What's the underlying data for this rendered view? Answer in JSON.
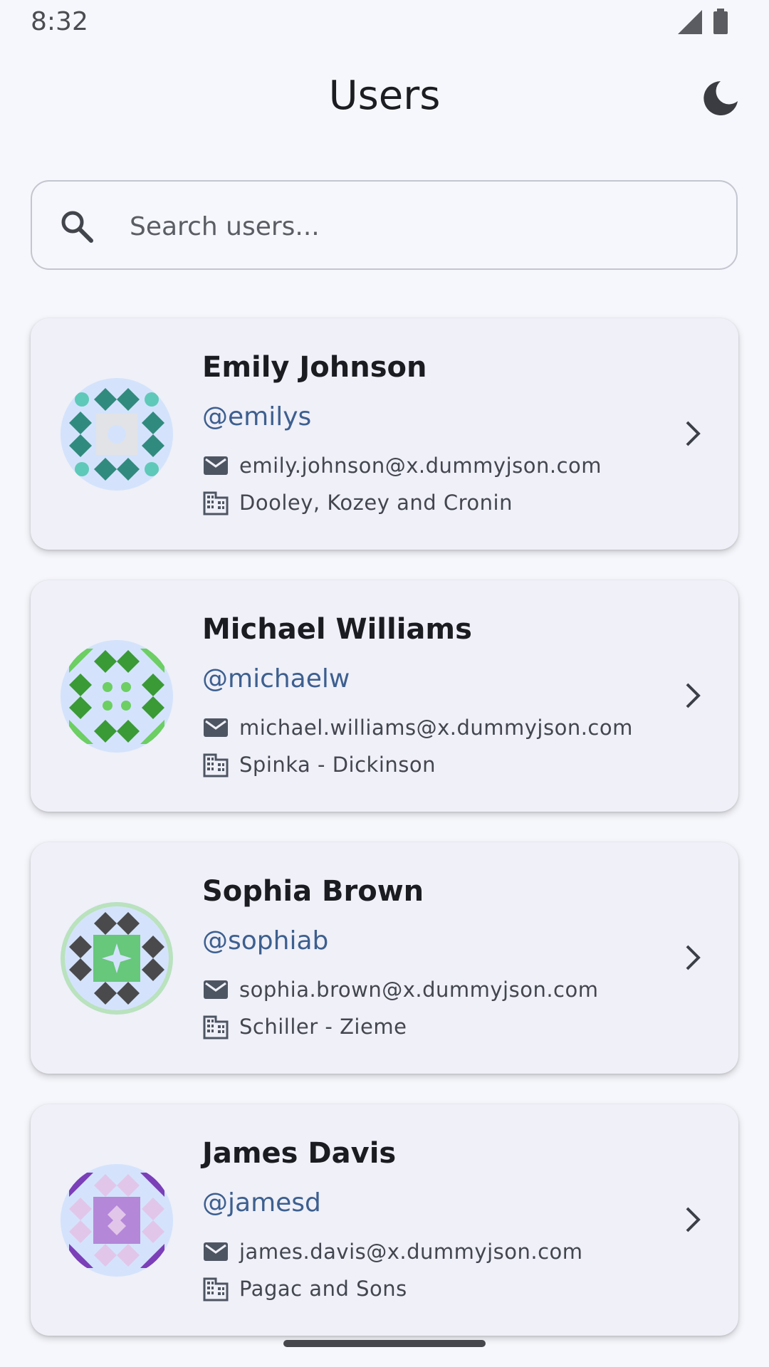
{
  "status": {
    "time": "8:32"
  },
  "header": {
    "title": "Users",
    "theme_icon": "moon-icon"
  },
  "search": {
    "placeholder": "Search users...",
    "value": ""
  },
  "colors": {
    "background": "#f6f7fc",
    "card": "#eff0f8",
    "handle": "#3d5f8f",
    "avatar_bg": "#d4e3fb"
  },
  "users": [
    {
      "name": "Emily Johnson",
      "handle": "@emilys",
      "email": "emily.johnson@x.dummyjson.com",
      "company": "Dooley, Kozey and Cronin"
    },
    {
      "name": "Michael Williams",
      "handle": "@michaelw",
      "email": "michael.williams@x.dummyjson.com",
      "company": "Spinka - Dickinson"
    },
    {
      "name": "Sophia Brown",
      "handle": "@sophiab",
      "email": "sophia.brown@x.dummyjson.com",
      "company": "Schiller - Zieme"
    },
    {
      "name": "James Davis",
      "handle": "@jamesd",
      "email": "james.davis@x.dummyjson.com",
      "company": "Pagac and Sons"
    }
  ]
}
